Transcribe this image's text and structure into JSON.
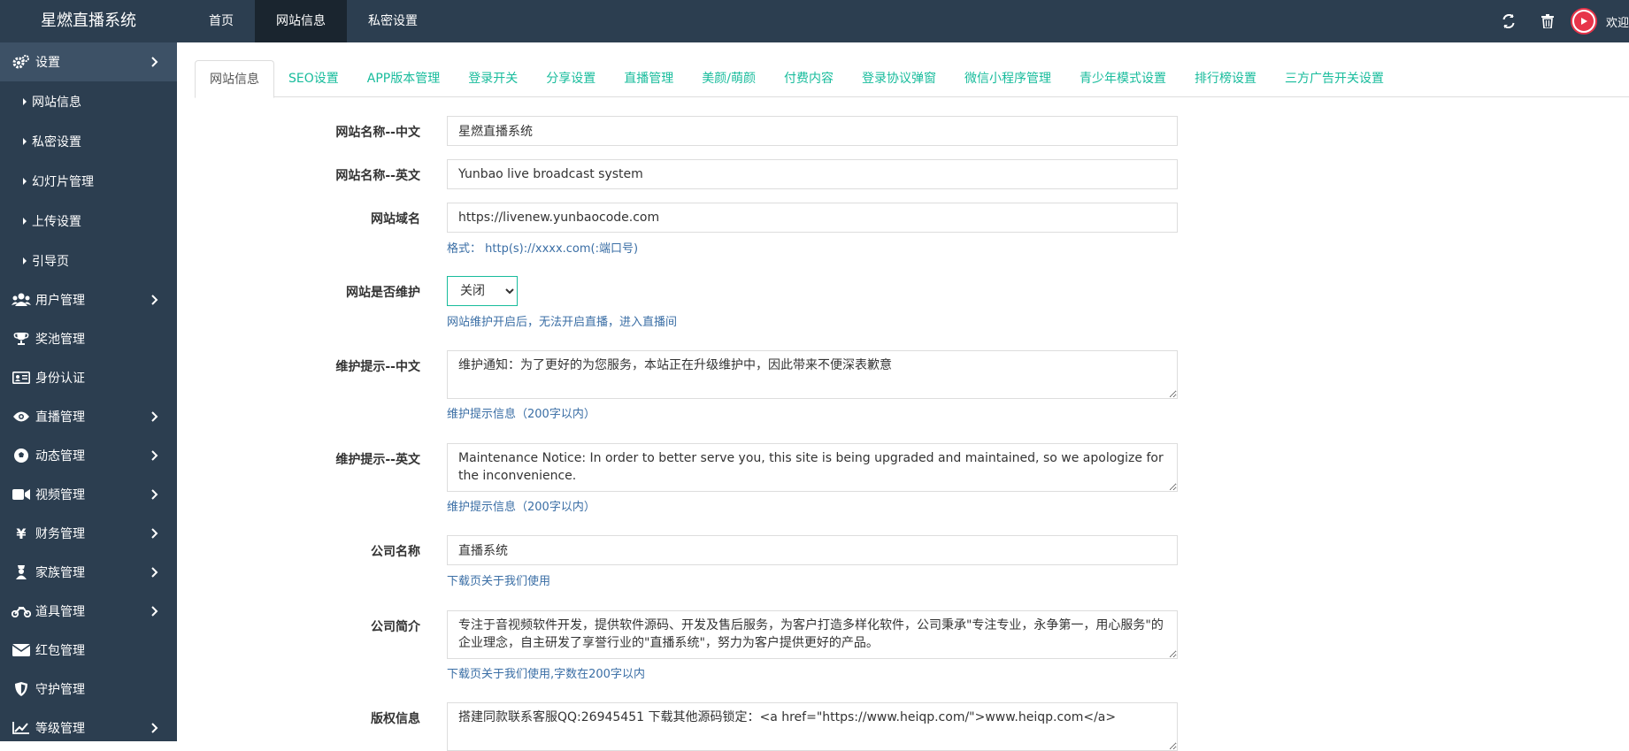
{
  "brand": "星燃直播系统",
  "topnav": [
    "首页",
    "网站信息",
    "私密设置"
  ],
  "welcome": "欢迎,",
  "sidebar": {
    "settings": "设置",
    "sub": [
      "网站信息",
      "私密设置",
      "幻灯片管理",
      "上传设置",
      "引导页"
    ],
    "items": [
      {
        "label": "用户管理",
        "icon": "users-icon",
        "chev": true
      },
      {
        "label": "奖池管理",
        "icon": "trophy-icon",
        "chev": false
      },
      {
        "label": "身份认证",
        "icon": "id-card-icon",
        "chev": false
      },
      {
        "label": "直播管理",
        "icon": "eye-icon",
        "chev": true
      },
      {
        "label": "动态管理",
        "icon": "ball-icon",
        "chev": true
      },
      {
        "label": "视频管理",
        "icon": "video-icon",
        "chev": true
      },
      {
        "label": "财务管理",
        "icon": "yen-icon",
        "chev": true
      },
      {
        "label": "家族管理",
        "icon": "family-icon",
        "chev": true
      },
      {
        "label": "道具管理",
        "icon": "motorcycle-icon",
        "chev": true
      },
      {
        "label": "红包管理",
        "icon": "envelope-icon",
        "chev": false
      },
      {
        "label": "守护管理",
        "icon": "shield-icon",
        "chev": false
      },
      {
        "label": "等级管理",
        "icon": "chart-icon",
        "chev": true
      }
    ]
  },
  "tabs": [
    "网站信息",
    "SEO设置",
    "APP版本管理",
    "登录开关",
    "分享设置",
    "直播管理",
    "美颜/萌颜",
    "付费内容",
    "登录协议弹窗",
    "微信小程序管理",
    "青少年模式设置",
    "排行榜设置",
    "三方广告开关设置"
  ],
  "form": {
    "name_cn_label": "网站名称--中文",
    "name_cn_value": "星燃直播系统",
    "name_en_label": "网站名称--英文",
    "name_en_value": "Yunbao live broadcast system",
    "domain_label": "网站域名",
    "domain_value": "https://livenew.yunbaocode.com",
    "domain_help": "格式： http(s)://xxxx.com(:端口号)",
    "maint_label": "网站是否维护",
    "maint_value": "关闭",
    "maint_help": "网站维护开启后，无法开启直播，进入直播间",
    "tip_cn_label": "维护提示--中文",
    "tip_cn_value": "维护通知：为了更好的为您服务，本站正在升级维护中，因此带来不便深表歉意",
    "tip_cn_help": "维护提示信息（200字以内）",
    "tip_en_label": "维护提示--英文",
    "tip_en_value": "Maintenance Notice: In order to better serve you, this site is being upgraded and maintained, so we apologize for the inconvenience.",
    "tip_en_help": "维护提示信息（200字以内）",
    "company_label": "公司名称",
    "company_value": "直播系统",
    "company_help": "下载页关于我们使用",
    "intro_label": "公司简介",
    "intro_value": "专注于音视频软件开发，提供软件源码、开发及售后服务，为客户打造多样化软件，公司秉承\"专注专业，永争第一，用心服务\"的企业理念，自主研发了享誉行业的\"直播系统\"，努力为客户提供更好的产品。",
    "intro_help": "下载页关于我们使用,字数在200字以内",
    "copyright_label": "版权信息",
    "copyright_value": "搭建同款联系客服QQ:26945451 下载其他源码锁定：<a href=\"https://www.heiqp.com/\">www.heiqp.com</a>"
  }
}
